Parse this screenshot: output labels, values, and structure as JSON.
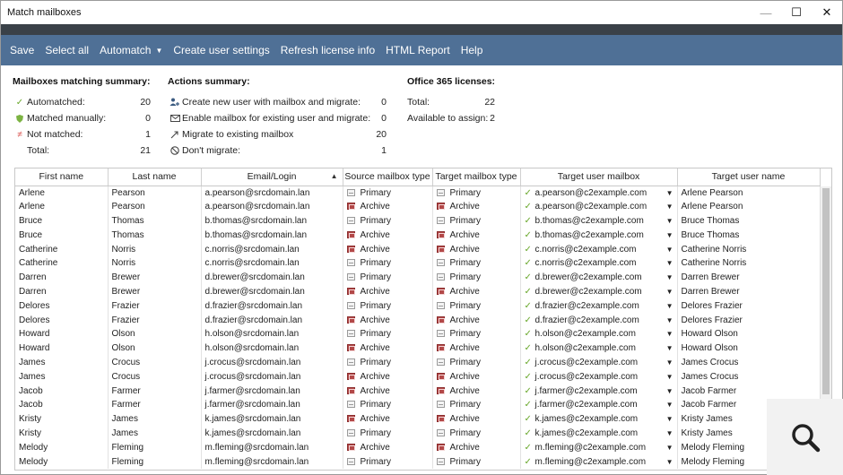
{
  "window": {
    "title": "Match mailboxes"
  },
  "menu": {
    "items": [
      "Save",
      "Select all",
      "Automatch",
      "Create user settings",
      "Refresh license info",
      "HTML Report",
      "Help"
    ]
  },
  "summary_matching": {
    "title": "Mailboxes matching summary:",
    "rows": [
      {
        "label": "Automatched:",
        "value": "20"
      },
      {
        "label": "Matched manually:",
        "value": "0"
      },
      {
        "label": "Not matched:",
        "value": "1"
      },
      {
        "label": "Total:",
        "value": "21"
      }
    ]
  },
  "summary_actions": {
    "title": "Actions summary:",
    "rows": [
      {
        "label": "Create new user with mailbox and migrate:",
        "value": "0"
      },
      {
        "label": "Enable mailbox for existing user and migrate:",
        "value": "0"
      },
      {
        "label": "Migrate to existing mailbox",
        "value": "20"
      },
      {
        "label": "Don't migrate:",
        "value": "1"
      }
    ]
  },
  "summary_licenses": {
    "title": "Office 365 licenses:",
    "rows": [
      {
        "label": "Total:",
        "value": "22"
      },
      {
        "label": "Available to assign:",
        "value": "2"
      }
    ]
  },
  "grid": {
    "columns": [
      "First name",
      "Last name",
      "Email/Login",
      "Source mailbox type",
      "Target mailbox type",
      "Target user mailbox",
      "Target user name"
    ],
    "rows": [
      [
        "Arlene",
        "Pearson",
        "a.pearson@srcdomain.lan",
        "Primary",
        "Primary",
        "a.pearson@c2example.com",
        "Arlene Pearson"
      ],
      [
        "Arlene",
        "Pearson",
        "a.pearson@srcdomain.lan",
        "Archive",
        "Archive",
        "a.pearson@c2example.com",
        "Arlene Pearson"
      ],
      [
        "Bruce",
        "Thomas",
        "b.thomas@srcdomain.lan",
        "Primary",
        "Primary",
        "b.thomas@c2example.com",
        "Bruce Thomas"
      ],
      [
        "Bruce",
        "Thomas",
        "b.thomas@srcdomain.lan",
        "Archive",
        "Archive",
        "b.thomas@c2example.com",
        "Bruce Thomas"
      ],
      [
        "Catherine",
        "Norris",
        "c.norris@srcdomain.lan",
        "Archive",
        "Archive",
        "c.norris@c2example.com",
        "Catherine Norris"
      ],
      [
        "Catherine",
        "Norris",
        "c.norris@srcdomain.lan",
        "Primary",
        "Primary",
        "c.norris@c2example.com",
        "Catherine Norris"
      ],
      [
        "Darren",
        "Brewer",
        "d.brewer@srcdomain.lan",
        "Primary",
        "Primary",
        "d.brewer@c2example.com",
        "Darren Brewer"
      ],
      [
        "Darren",
        "Brewer",
        "d.brewer@srcdomain.lan",
        "Archive",
        "Archive",
        "d.brewer@c2example.com",
        "Darren Brewer"
      ],
      [
        "Delores",
        "Frazier",
        "d.frazier@srcdomain.lan",
        "Primary",
        "Primary",
        "d.frazier@c2example.com",
        "Delores Frazier"
      ],
      [
        "Delores",
        "Frazier",
        "d.frazier@srcdomain.lan",
        "Archive",
        "Archive",
        "d.frazier@c2example.com",
        "Delores Frazier"
      ],
      [
        "Howard",
        "Olson",
        "h.olson@srcdomain.lan",
        "Primary",
        "Primary",
        "h.olson@c2example.com",
        "Howard Olson"
      ],
      [
        "Howard",
        "Olson",
        "h.olson@srcdomain.lan",
        "Archive",
        "Archive",
        "h.olson@c2example.com",
        "Howard Olson"
      ],
      [
        "James",
        "Crocus",
        "j.crocus@srcdomain.lan",
        "Primary",
        "Primary",
        "j.crocus@c2example.com",
        "James Crocus"
      ],
      [
        "James",
        "Crocus",
        "j.crocus@srcdomain.lan",
        "Archive",
        "Archive",
        "j.crocus@c2example.com",
        "James Crocus"
      ],
      [
        "Jacob",
        "Farmer",
        "j.farmer@srcdomain.lan",
        "Archive",
        "Archive",
        "j.farmer@c2example.com",
        "Jacob Farmer"
      ],
      [
        "Jacob",
        "Farmer",
        "j.farmer@srcdomain.lan",
        "Primary",
        "Primary",
        "j.farmer@c2example.com",
        "Jacob Farmer"
      ],
      [
        "Kristy",
        "James",
        "k.james@srcdomain.lan",
        "Archive",
        "Archive",
        "k.james@c2example.com",
        "Kristy James"
      ],
      [
        "Kristy",
        "James",
        "k.james@srcdomain.lan",
        "Primary",
        "Primary",
        "k.james@c2example.com",
        "Kristy James"
      ],
      [
        "Melody",
        "Fleming",
        "m.fleming@srcdomain.lan",
        "Archive",
        "Archive",
        "m.fleming@c2example.com",
        "Melody Fleming"
      ],
      [
        "Melody",
        "Fleming",
        "m.fleming@srcdomain.lan",
        "Primary",
        "Primary",
        "m.fleming@c2example.com",
        "Melody Fleming"
      ]
    ]
  },
  "icons": {
    "automatched": "check-icon",
    "matched_manually": "shield-icon",
    "not_matched": "not-equal-icon",
    "create_user": "add-user-icon",
    "enable_mailbox": "envelope-icon",
    "migrate": "arrow-right-icon",
    "dont_migrate": "prohibited-icon",
    "zoom": "magnifier-icon"
  },
  "colors": {
    "menubar": "#4f7096",
    "check": "#6aa82c",
    "not_matched": "#d9534f",
    "archive": "#b24848"
  }
}
